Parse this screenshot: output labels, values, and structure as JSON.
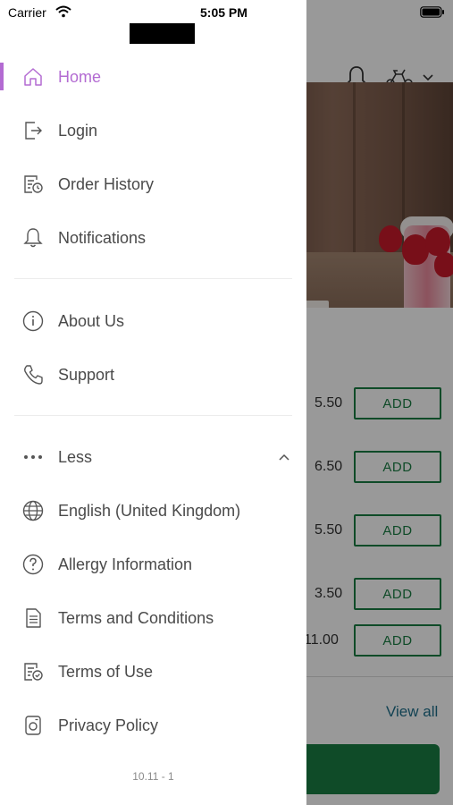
{
  "status_bar": {
    "carrier": "Carrier",
    "time": "5:05 PM"
  },
  "menu": {
    "primary": [
      {
        "label": "Home",
        "icon": "home-icon",
        "active": true
      },
      {
        "label": "Login",
        "icon": "login-icon"
      },
      {
        "label": "Order History",
        "icon": "order-history-icon"
      },
      {
        "label": "Notifications",
        "icon": "bell-icon"
      }
    ],
    "secondary": [
      {
        "label": "About Us",
        "icon": "info-icon"
      },
      {
        "label": "Support",
        "icon": "phone-icon"
      }
    ],
    "more": [
      {
        "label": "Less",
        "icon": "more-dots-icon"
      },
      {
        "label": "English (United Kingdom)",
        "icon": "globe-icon"
      },
      {
        "label": "Allergy Information",
        "icon": "question-icon"
      },
      {
        "label": "Terms and Conditions",
        "icon": "document-icon"
      },
      {
        "label": "Terms of Use",
        "icon": "document-check-icon"
      },
      {
        "label": "Privacy Policy",
        "icon": "privacy-icon"
      }
    ]
  },
  "version": "10.11 - 1",
  "background": {
    "items": [
      {
        "price": "5.50",
        "button": "ADD"
      },
      {
        "price": "6.50",
        "button": "ADD"
      },
      {
        "price": "5.50",
        "button": "ADD"
      },
      {
        "price": "3.50",
        "button": "ADD"
      },
      {
        "price": "11.00",
        "button": "ADD"
      }
    ],
    "view_all": "View all"
  },
  "colors": {
    "accent": "#b36bd2",
    "brand_green": "#1a7d43",
    "link": "#1f6f8b"
  }
}
